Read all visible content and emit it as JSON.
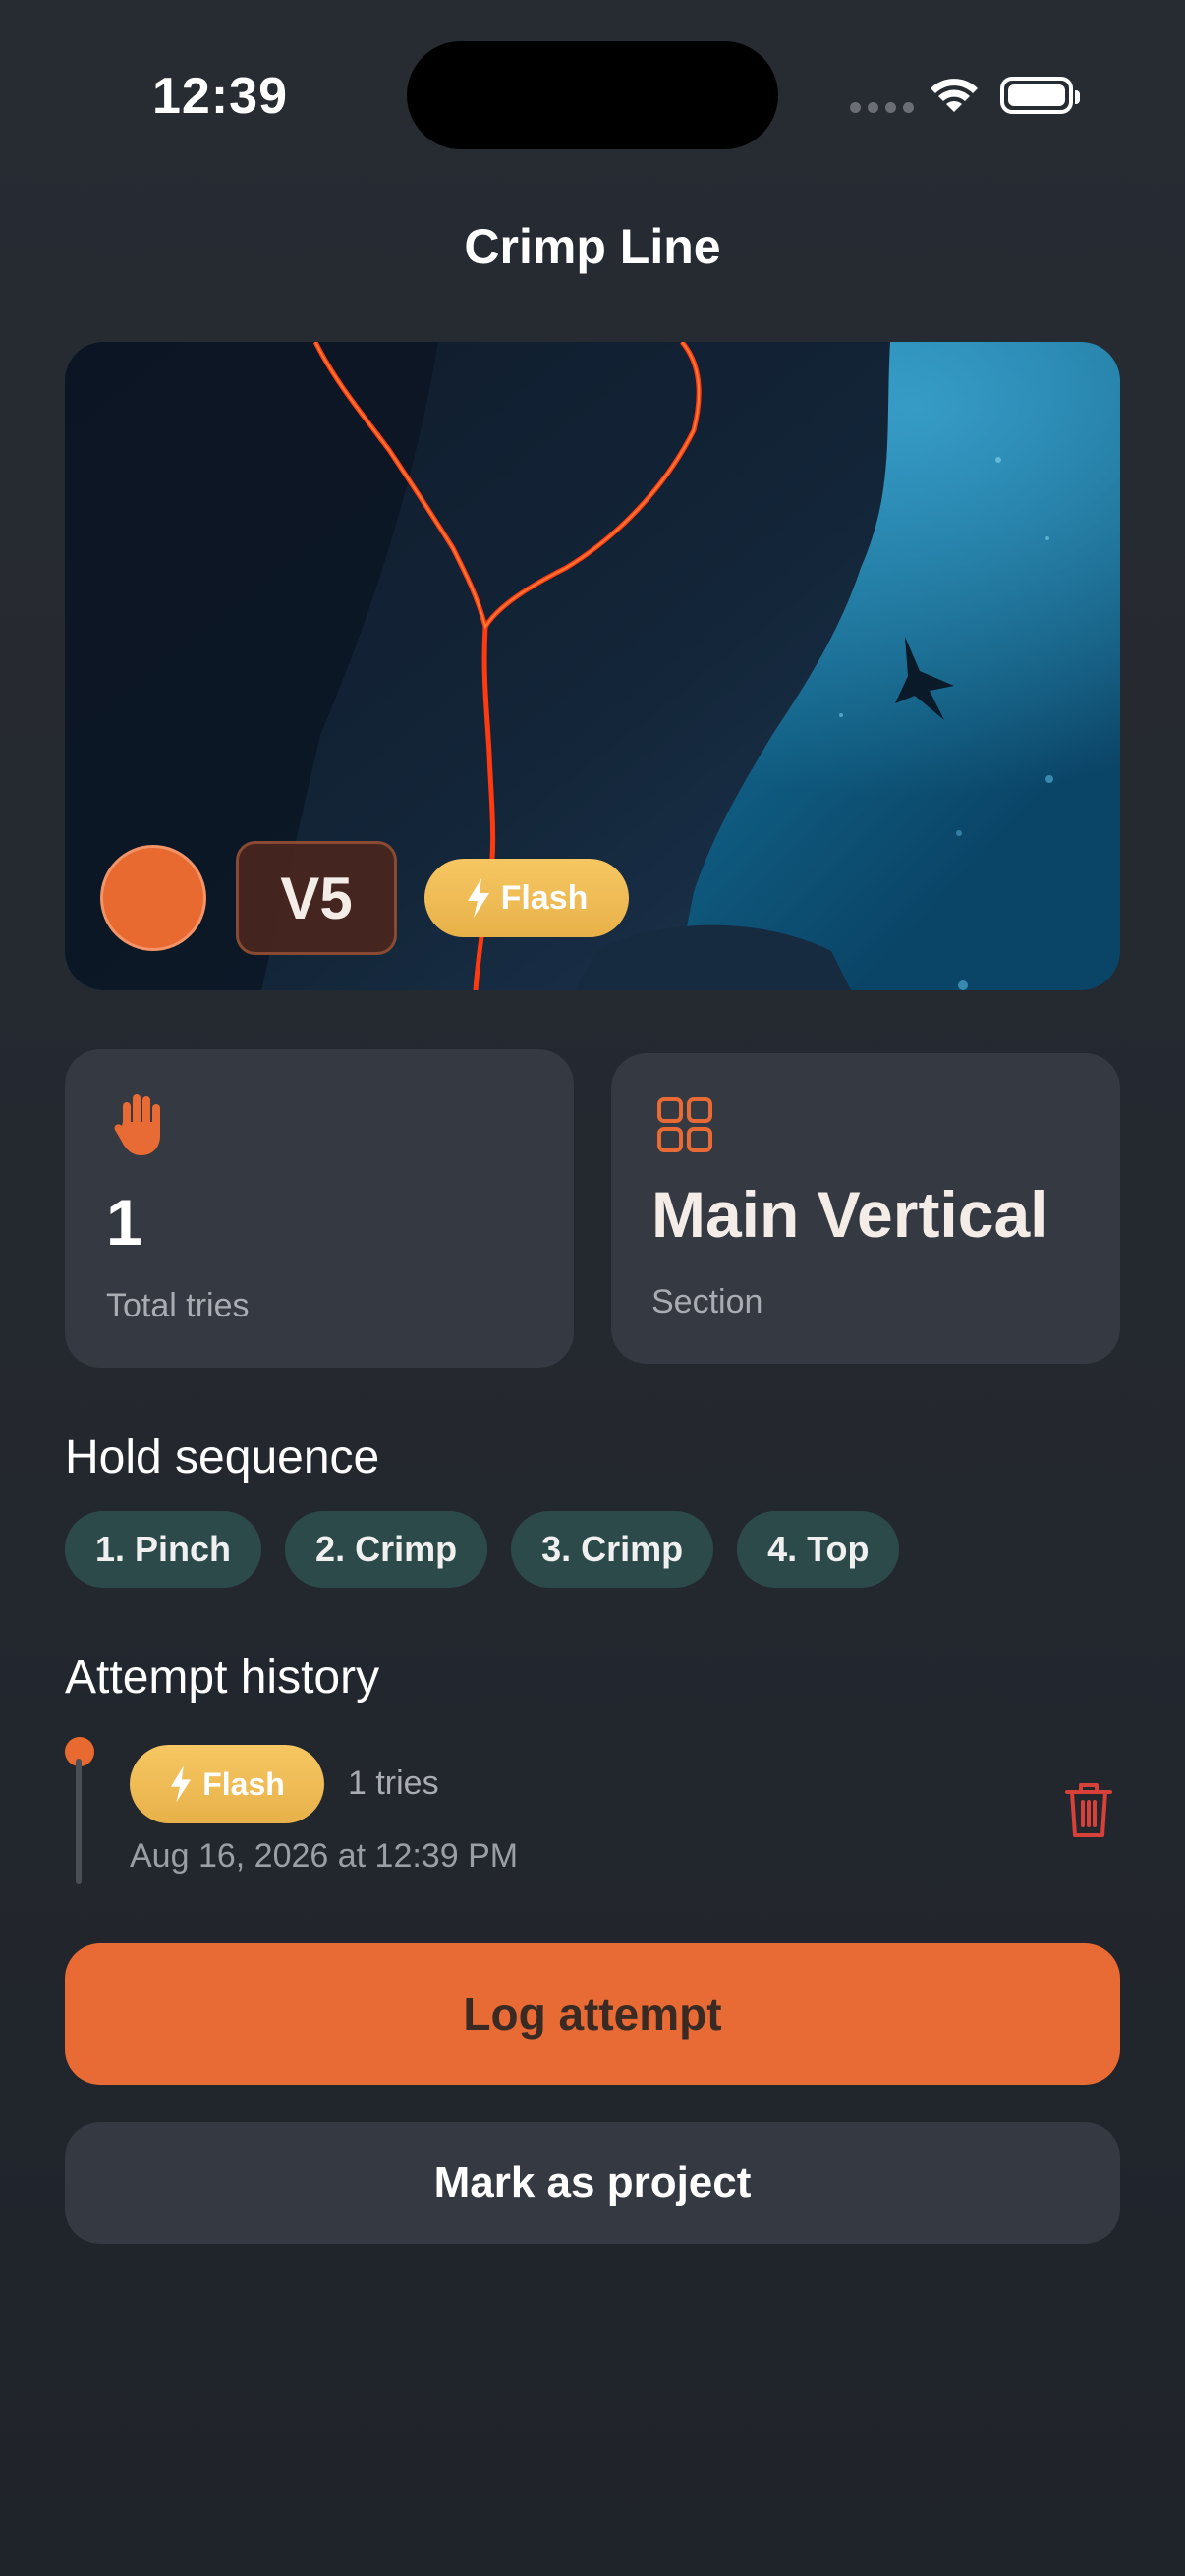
{
  "status_bar": {
    "time": "12:39"
  },
  "header": {
    "title": "Crimp Line"
  },
  "hero": {
    "grade": "V5",
    "flash_label": "Flash",
    "hold_color": "#e86a30"
  },
  "stats": {
    "tries_value": "1",
    "tries_label": "Total tries",
    "section_value": "Main Vertical",
    "section_label": "Section"
  },
  "hold_sequence": {
    "heading": "Hold sequence",
    "holds": [
      "1. Pinch",
      "2. Crimp",
      "3. Crimp",
      "4. Top"
    ]
  },
  "attempt_history": {
    "heading": "Attempt history",
    "entries": [
      {
        "type": "Flash",
        "tries": "1 tries",
        "date": "Aug 16, 2026 at 12:39 PM"
      }
    ]
  },
  "actions": {
    "log_attempt": "Log attempt",
    "mark_project": "Mark as project"
  },
  "colors": {
    "accent": "#e86a35",
    "flash": "#f1bd55",
    "chip_bg": "#2d4a4a",
    "delete": "#d8403a"
  }
}
